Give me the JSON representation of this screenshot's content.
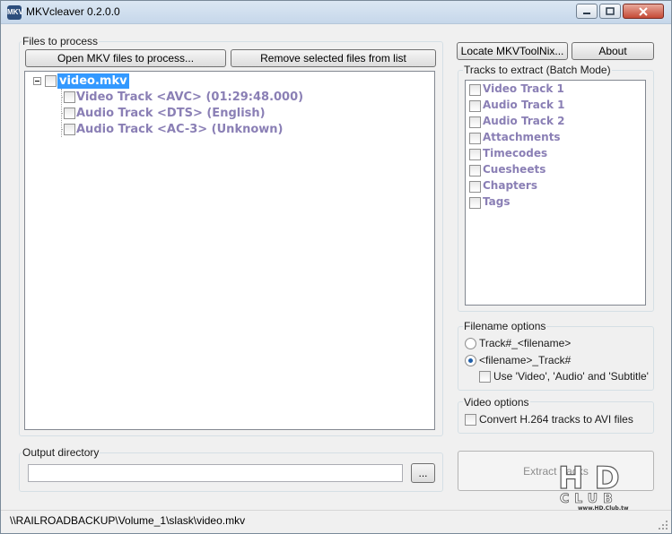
{
  "window": {
    "title": "MKVcleaver 0.2.0.0",
    "icon": "mkv-app-icon"
  },
  "files": {
    "group_label": "Files to process",
    "open_button": "Open MKV files to process...",
    "remove_button": "Remove selected files from list",
    "tree": {
      "root": "video.mkv",
      "children": [
        "Video Track <AVC> (01:29:48.000)",
        "Audio Track <DTS> (English)",
        "Audio Track <AC-3> (Unknown)"
      ]
    }
  },
  "top_buttons": {
    "locate": "Locate MKVToolNix...",
    "about": "About"
  },
  "tracks": {
    "group_label": "Tracks to extract (Batch Mode)",
    "items": [
      "Video Track 1",
      "Audio Track 1",
      "Audio Track 2",
      "Attachments",
      "Timecodes",
      "Cuesheets",
      "Chapters",
      "Tags"
    ]
  },
  "filename_options": {
    "group_label": "Filename options",
    "option1": "Track#_<filename>",
    "option2": "<filename>_Track#",
    "selected": "option2",
    "use_names": "Use 'Video', 'Audio' and 'Subtitle'"
  },
  "video_options": {
    "group_label": "Video options",
    "convert": "Convert H.264 tracks to AVI files"
  },
  "output": {
    "group_label": "Output directory",
    "value": "",
    "browse": "..."
  },
  "extract_button": "Extract tracks",
  "status": "\\\\RAILROADBACKUP\\Volume_1\\slask\\video.mkv",
  "watermark": {
    "main": "HD",
    "sub": "CLUB",
    "site": "www.HD.Club.tw"
  },
  "colors": {
    "tree_text": "#8a7fb5",
    "selection": "#3399ff",
    "close_button": "#c44a36"
  }
}
